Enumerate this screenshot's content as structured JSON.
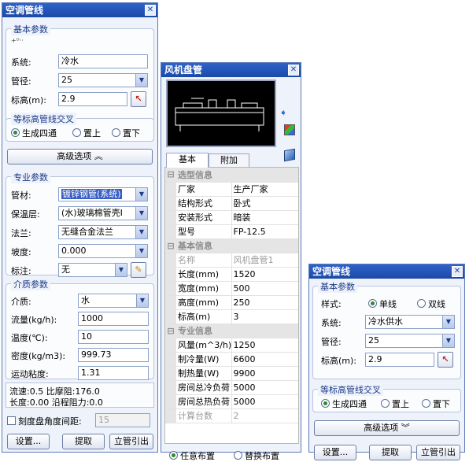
{
  "left": {
    "title": "空调管线",
    "basic_group": "基本参数",
    "tag": "+ᴰ··",
    "system_label": "系统:",
    "system_value": "冷水",
    "diameter_label": "管径:",
    "diameter_value": "25",
    "elev_label": "标高(m):",
    "elev_value": "2.9",
    "cross_group": "等标高管线交叉",
    "radio_1": "生成四通",
    "radio_2": "置上",
    "radio_3": "置下",
    "advanced_btn": "高级选项 ︽",
    "pro_group": "专业参数",
    "material_label": "管材:",
    "material_value": "镀锌钢管(系统)",
    "insul_label": "保温层:",
    "insul_value": "(水)玻璃棉管壳I",
    "flange_label": "法兰:",
    "flange_value": "无缝合金法兰",
    "slope_label": "坡度:",
    "slope_value": "0.000",
    "note_label": "标注:",
    "note_value": "无",
    "medium_group": "介质参数",
    "medium_label": "介质:",
    "medium_value": "水",
    "flow_label": "流量(kg/h):",
    "flow_value": "1000",
    "temp_label": "温度(℃):",
    "temp_value": "10",
    "density_label": "密度(kg/m3):",
    "density_value": "999.73",
    "visc_label": "运动粘度:",
    "visc_value": "1.31",
    "info_1": "流速:0.5   比摩阻:176.0",
    "info_2": "长度:0.00   沿程阻力:0.0",
    "scale_label": "刻度盘角度间距:",
    "scale_value": "15",
    "btn_settings": "设置...",
    "btn_pick": "提取",
    "btn_riser": "立管引出"
  },
  "mid": {
    "title": "风机盘管",
    "tab_basic": "基本",
    "tab_extra": "附加",
    "props": [
      {
        "cat": "选型信息"
      },
      {
        "k": "厂家",
        "v": "生产厂家"
      },
      {
        "k": "结构形式",
        "v": "卧式"
      },
      {
        "k": "安装形式",
        "v": "暗装"
      },
      {
        "k": "型号",
        "v": "FP-12.5"
      },
      {
        "cat": "基本信息"
      },
      {
        "k": "名称",
        "v": "风机盘管1",
        "dim": true
      },
      {
        "k": "长度(mm)",
        "v": "1520"
      },
      {
        "k": "宽度(mm)",
        "v": "500"
      },
      {
        "k": "高度(mm)",
        "v": "250"
      },
      {
        "k": "标高(m)",
        "v": "3"
      },
      {
        "cat": "专业信息"
      },
      {
        "k": "风量(m^3/h)",
        "v": "1250"
      },
      {
        "k": "制冷量(W)",
        "v": "6600"
      },
      {
        "k": "制热量(W)",
        "v": "9900"
      },
      {
        "k": "房间总冷负荷",
        "v": "5000"
      },
      {
        "k": "房间总热负荷",
        "v": "5000"
      },
      {
        "k": "计算台数",
        "v": "2",
        "dim": true
      }
    ],
    "radio_any": "任意布置",
    "radio_replace": "替换布置"
  },
  "right": {
    "title": "空调管线",
    "basic_group": "基本参数",
    "style_label": "样式:",
    "style_1": "单线",
    "style_2": "双线",
    "system_label": "系统:",
    "system_value": "冷水供水",
    "diameter_label": "管径:",
    "diameter_value": "25",
    "elev_label": "标高(m):",
    "elev_value": "2.9",
    "cross_group": "等标高管线交叉",
    "radio_1": "生成四通",
    "radio_2": "置上",
    "radio_3": "置下",
    "advanced_btn": "高级选项 ︾",
    "btn_settings": "设置...",
    "btn_pick": "提取",
    "btn_riser": "立管引出"
  }
}
